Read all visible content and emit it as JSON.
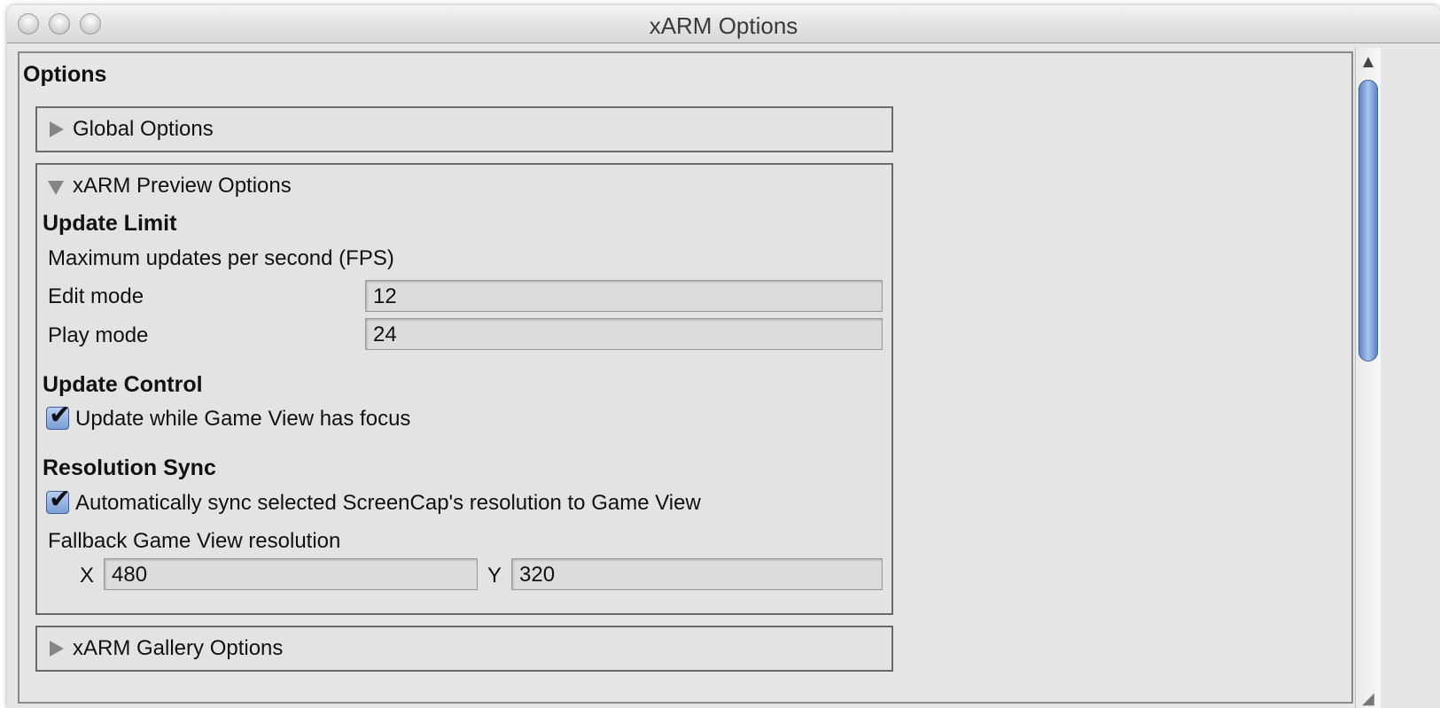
{
  "window": {
    "title": "xARM Options"
  },
  "options": {
    "heading": "Options",
    "global_options": {
      "label": "Global Options",
      "expanded": false
    },
    "preview_options": {
      "label": "xARM Preview Options",
      "expanded": true,
      "update_limit": {
        "heading": "Update Limit",
        "description": "Maximum updates per second (FPS)",
        "edit_mode_label": "Edit mode",
        "edit_mode_value": "12",
        "play_mode_label": "Play mode",
        "play_mode_value": "24"
      },
      "update_control": {
        "heading": "Update Control",
        "checkbox_label": "Update while Game View has focus",
        "checked": true
      },
      "resolution_sync": {
        "heading": "Resolution Sync",
        "checkbox_label": "Automatically sync selected ScreenCap's resolution to Game View",
        "checked": true,
        "fallback_label": "Fallback Game View resolution",
        "x_label": "X",
        "x_value": "480",
        "y_label": "Y",
        "y_value": "320"
      }
    },
    "gallery_options": {
      "label": "xARM Gallery Options",
      "expanded": false
    }
  },
  "icons": {
    "check": "✔"
  },
  "colors": {
    "checkbox_accent": "#7b9ed8",
    "scroll_thumb": "#5d86c9",
    "panel_background": "#e6e6e6"
  }
}
